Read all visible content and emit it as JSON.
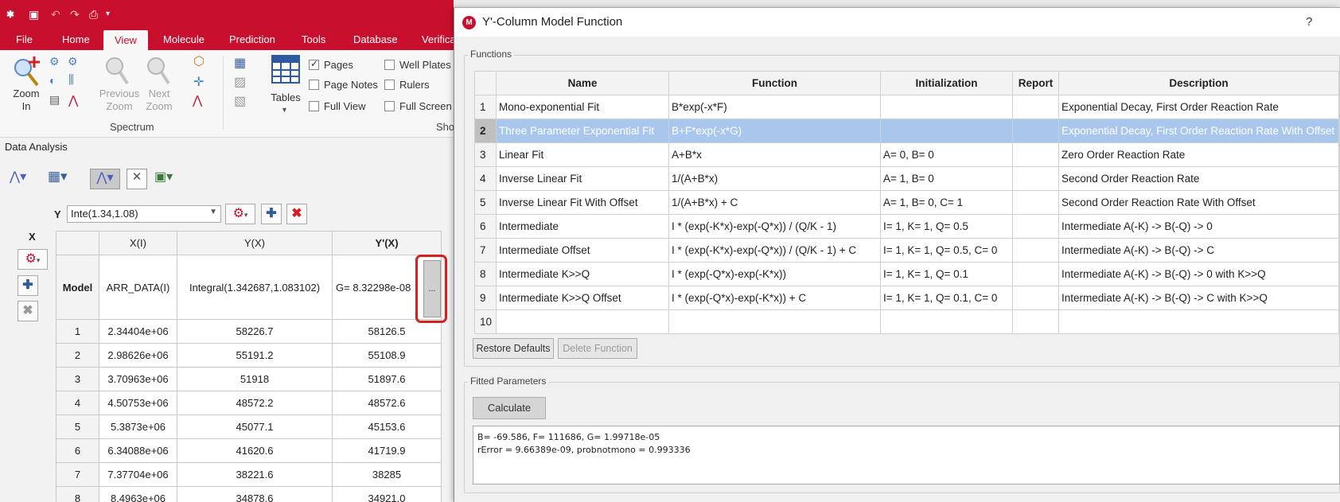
{
  "ribbon_tabs": [
    "File",
    "Home",
    "View",
    "Molecule",
    "Prediction",
    "Tools",
    "Database",
    "Verifica"
  ],
  "active_tab": "View",
  "ribbon": {
    "zoom_in": [
      "Zoom",
      "In"
    ],
    "previous_zoom": [
      "Previous",
      "Zoom"
    ],
    "next_zoom": [
      "Next",
      "Zoom"
    ],
    "spectrum_group": "Spectrum",
    "tables": "Tables",
    "show_group": "Sho",
    "checks": [
      {
        "label": "Pages",
        "checked": true
      },
      {
        "label": "Page Notes",
        "checked": false
      },
      {
        "label": "Full View",
        "checked": false
      },
      {
        "label": "Well Plates",
        "checked": false
      },
      {
        "label": "Rulers",
        "checked": false
      },
      {
        "label": "Full Screen",
        "checked": false
      }
    ]
  },
  "data_analysis": {
    "title": "Data Analysis",
    "y_label": "Y",
    "y_value": "Inte(1.34,1.08)",
    "x_label": "X",
    "columns": [
      "X(I)",
      "Y(X)",
      "Y'(X)"
    ],
    "model_row": {
      "label": "Model",
      "x": "ARR_DATA(I)",
      "y": "Integral(1.342687,1.083102)",
      "yp": "G= 8.32298e-08",
      "dots": "..."
    },
    "rows": [
      {
        "n": "1",
        "x": "2.34404e+06",
        "y": "58226.7",
        "yp": "58126.5"
      },
      {
        "n": "2",
        "x": "2.98626e+06",
        "y": "55191.2",
        "yp": "55108.9"
      },
      {
        "n": "3",
        "x": "3.70963e+06",
        "y": "51918",
        "yp": "51897.6"
      },
      {
        "n": "4",
        "x": "4.50753e+06",
        "y": "48572.2",
        "yp": "48572.6"
      },
      {
        "n": "5",
        "x": "5.3873e+06",
        "y": "45077.1",
        "yp": "45153.6"
      },
      {
        "n": "6",
        "x": "6.34088e+06",
        "y": "41620.6",
        "yp": "41719.9"
      },
      {
        "n": "7",
        "x": "7.37704e+06",
        "y": "38221.6",
        "yp": "38285"
      },
      {
        "n": "8",
        "x": "8.4963e+06",
        "y": "34878.6",
        "yp": "34921.0"
      }
    ]
  },
  "dialog": {
    "title": "Y'-Column Model Function",
    "help": "?",
    "functions_label": "Functions",
    "headers": [
      "Name",
      "Function",
      "Initialization",
      "Report",
      "Description"
    ],
    "rows": [
      {
        "n": "1",
        "name": "Mono-exponential Fit",
        "func": "B*exp(-x*F)",
        "init": "",
        "report": "",
        "desc": "Exponential Decay, First Order Reaction Rate"
      },
      {
        "n": "2",
        "name": "Three Parameter Exponential Fit",
        "func": "B+F*exp(-x*G)",
        "init": "",
        "report": "",
        "desc": "Exponential Decay, First Order Reaction Rate With Offset"
      },
      {
        "n": "3",
        "name": "Linear Fit",
        "func": "A+B*x",
        "init": "A= 0, B= 0",
        "report": "",
        "desc": "Zero Order Reaction Rate"
      },
      {
        "n": "4",
        "name": "Inverse Linear Fit",
        "func": "1/(A+B*x)",
        "init": "A= 1, B= 0",
        "report": "",
        "desc": "Second Order Reaction Rate"
      },
      {
        "n": "5",
        "name": "Inverse Linear Fit With Offset",
        "func": "1/(A+B*x) + C",
        "init": "A= 1, B= 0, C= 1",
        "report": "",
        "desc": "Second Order Reaction Rate With Offset"
      },
      {
        "n": "6",
        "name": "Intermediate",
        "func": "I * (exp(-K*x)-exp(-Q*x)) / (Q/K - 1)",
        "init": "I= 1, K= 1, Q= 0.5",
        "report": "",
        "desc": "Intermediate A(-K) -> B(-Q) -> 0"
      },
      {
        "n": "7",
        "name": "Intermediate Offset",
        "func": "I * (exp(-K*x)-exp(-Q*x)) / (Q/K - 1) + C",
        "init": "I= 1, K= 1, Q= 0.5, C= 0",
        "report": "",
        "desc": "Intermediate A(-K) -> B(-Q) -> C"
      },
      {
        "n": "8",
        "name": "Intermediate K>>Q",
        "func": "I * (exp(-Q*x)-exp(-K*x))",
        "init": "I= 1, K= 1, Q= 0.1",
        "report": "",
        "desc": "Intermediate A(-K) -> B(-Q) -> 0 with K>>Q"
      },
      {
        "n": "9",
        "name": "Intermediate K>>Q Offset",
        "func": "I * (exp(-Q*x)-exp(-K*x)) + C",
        "init": "I= 1, K= 1, Q= 0.1, C= 0",
        "report": "",
        "desc": "Intermediate A(-K) -> B(-Q) -> C with K>>Q"
      },
      {
        "n": "10",
        "name": "",
        "func": "",
        "init": "",
        "report": "",
        "desc": ""
      }
    ],
    "selected_row": "2",
    "restore_defaults": "Restore Defaults",
    "delete_function": "Delete Function",
    "fitted_label": "Fitted Parameters",
    "calculate": "Calculate",
    "result_line1": "B= -69.586, F= 111686, G= 1.99718e-05",
    "result_line2": "rError = 9.66389e-09, probnotmono = 0.993336"
  },
  "colors": {
    "brand_red": "#c8102e",
    "selection_blue": "#a9c7ec",
    "highlight_red": "#d42020"
  }
}
